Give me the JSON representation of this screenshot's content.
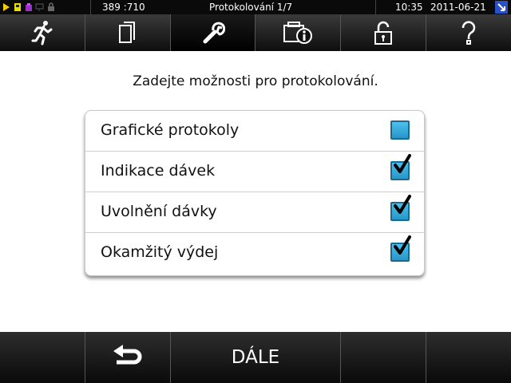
{
  "status": {
    "counter": "389 :710",
    "title": "Protokolování 1/7",
    "time": "10:35",
    "date": "2011-06-21",
    "icons": [
      "play-icon",
      "card-icon",
      "package-icon",
      "network-icon",
      "lock-small-icon"
    ]
  },
  "nav": {
    "tabs": [
      {
        "name": "runner-icon",
        "active": false
      },
      {
        "name": "documents-icon",
        "active": false
      },
      {
        "name": "wrench-icon",
        "active": true
      },
      {
        "name": "folder-info-icon",
        "active": false
      },
      {
        "name": "padlock-icon",
        "active": false
      },
      {
        "name": "help-icon",
        "active": false
      }
    ]
  },
  "content": {
    "prompt": "Zadejte možnosti pro protokolování.",
    "options": [
      {
        "label": "Grafické protokoly",
        "checked": false
      },
      {
        "label": "Indikace dávek",
        "checked": true
      },
      {
        "label": "Uvolnění dávky",
        "checked": true
      },
      {
        "label": "Okamžitý výdej",
        "checked": true
      }
    ]
  },
  "footer": {
    "back_icon": "back-arrow-icon",
    "next_label": "DÁLE"
  },
  "colors": {
    "checkbox": "#2796c8",
    "corner": "#2a52c8",
    "bar": "#0a0a0a"
  }
}
